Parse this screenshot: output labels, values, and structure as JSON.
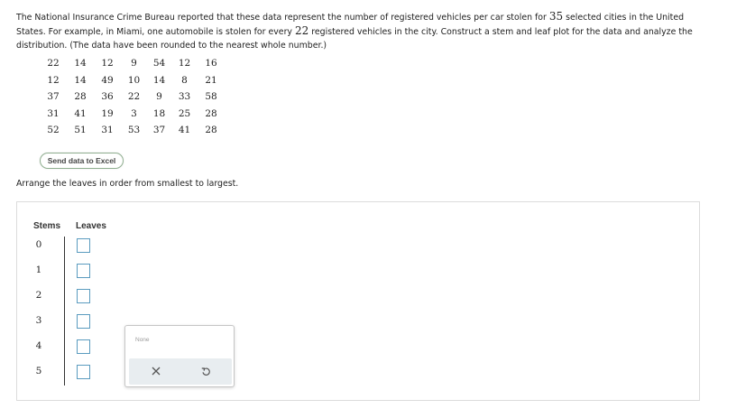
{
  "intro": {
    "part1": "The National Insurance Crime Bureau reported that these data represent the number of registered vehicles per car stolen for ",
    "num_cities": "35",
    "part2": " selected cities in the United States. For example, in Miami, one automobile is stolen for every ",
    "num_vehicles": "22",
    "part3": " registered vehicles in the city. Construct a stem and leaf plot for the data and analyze the distribution. (The data have been rounded to the nearest whole number.)"
  },
  "data_table": [
    [
      "22",
      "14",
      "12",
      "9",
      "54",
      "12",
      "16"
    ],
    [
      "12",
      "14",
      "49",
      "10",
      "14",
      "8",
      "21"
    ],
    [
      "37",
      "28",
      "36",
      "22",
      "9",
      "33",
      "58"
    ],
    [
      "31",
      "41",
      "19",
      "3",
      "18",
      "25",
      "28"
    ],
    [
      "52",
      "51",
      "31",
      "53",
      "37",
      "41",
      "28"
    ]
  ],
  "excel_button": "Send data to Excel",
  "instruction": "Arrange the leaves in order from smallest to largest.",
  "plot": {
    "stems_header": "Stems",
    "leaves_header": "Leaves",
    "stems": [
      "0",
      "1",
      "2",
      "3",
      "4",
      "5"
    ],
    "leaf_values": [
      "",
      "",
      "",
      "",
      "",
      ""
    ]
  },
  "popover": {
    "label": "None",
    "clear_icon": "close-icon",
    "reset_icon": "undo-icon"
  },
  "colors": {
    "input_border": "#5a9bbf",
    "action_bar": "#e8edf0"
  }
}
